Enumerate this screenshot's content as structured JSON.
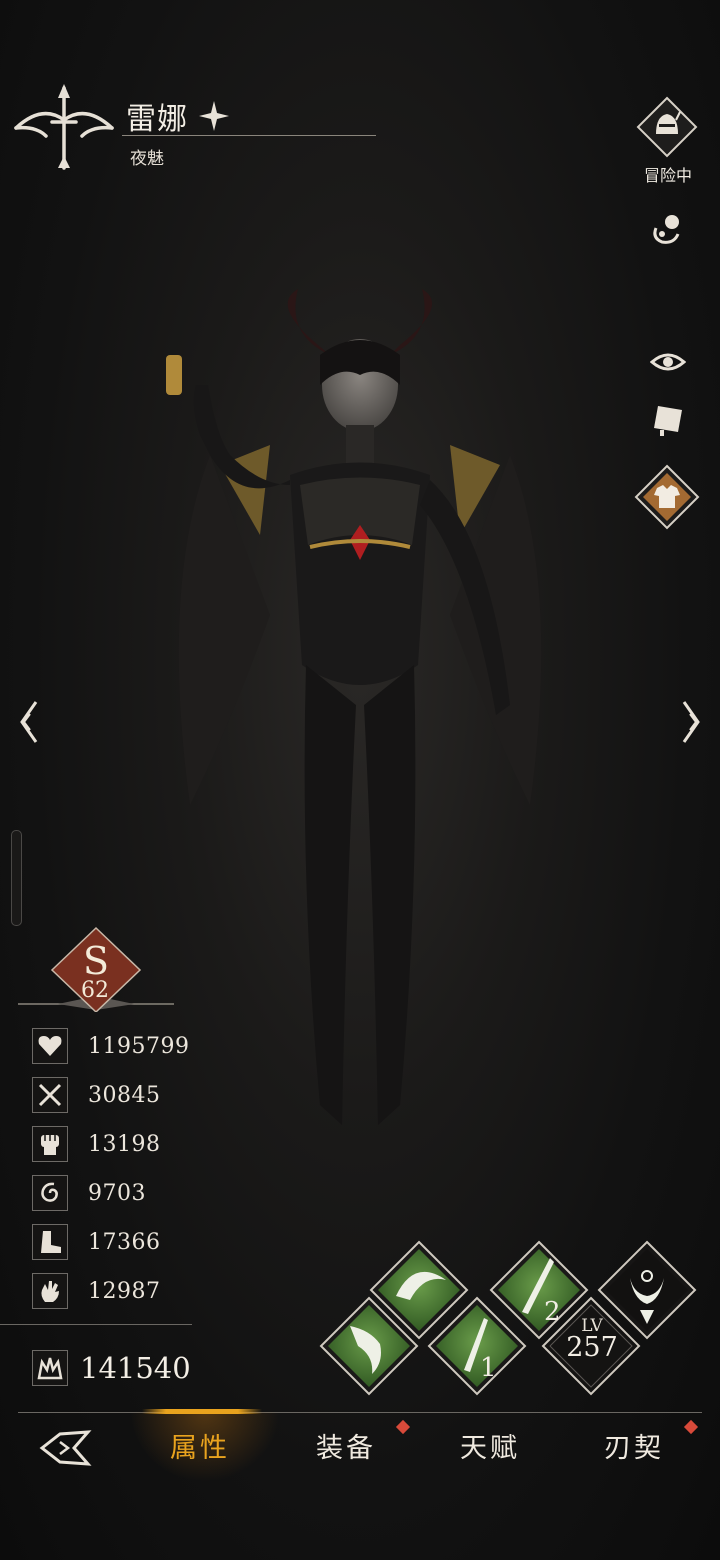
{
  "hero": {
    "name": "雷娜",
    "subtitle": "夜魅"
  },
  "side_buttons": {
    "adventure_label": "冒险中"
  },
  "rank": {
    "letter": "S",
    "level": "62"
  },
  "stats": [
    {
      "icon": "heart-icon",
      "value": "1195799"
    },
    {
      "icon": "crossed-swords-icon",
      "value": "30845"
    },
    {
      "icon": "fist-icon",
      "value": "13198"
    },
    {
      "icon": "spiral-icon",
      "value": "9703"
    },
    {
      "icon": "boot-icon",
      "value": "17366"
    },
    {
      "icon": "hand-icon",
      "value": "12987"
    }
  ],
  "power": {
    "value": "141540"
  },
  "level": {
    "label": "LV",
    "value": "257"
  },
  "skills": {
    "skill_1_number": "1",
    "skill_2_number": "2"
  },
  "tabs": {
    "attributes": "属性",
    "equipment": "装备",
    "talent": "天赋",
    "contract": "刃契"
  },
  "colors": {
    "accent": "#e9a31e",
    "skill_green": "#4f8a3a",
    "rank_red": "#8a3524",
    "notify_red": "#d84a3a"
  }
}
